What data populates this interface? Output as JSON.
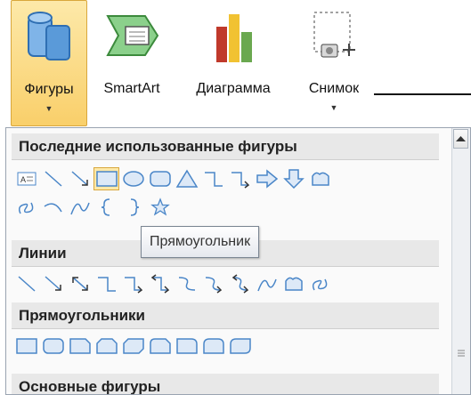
{
  "ribbon": {
    "shapes_label": "Фигуры",
    "smartart_label": "SmartArt",
    "chart_label": "Диаграмма",
    "screenshot_label": "Снимок",
    "dropdown_glyph": "▼"
  },
  "menu": {
    "section_recent": "Последние использованные фигуры",
    "section_lines": "Линии",
    "section_rectangles": "Прямоугольники",
    "section_basic": "Основные фигуры",
    "tooltip": "Прямоугольник"
  },
  "colors": {
    "accent": "#f9cf6a",
    "chart_red": "#c0392b",
    "chart_green": "#6aa84f",
    "chart_gold": "#f1c232",
    "icon_blue": "#4a86c8"
  }
}
